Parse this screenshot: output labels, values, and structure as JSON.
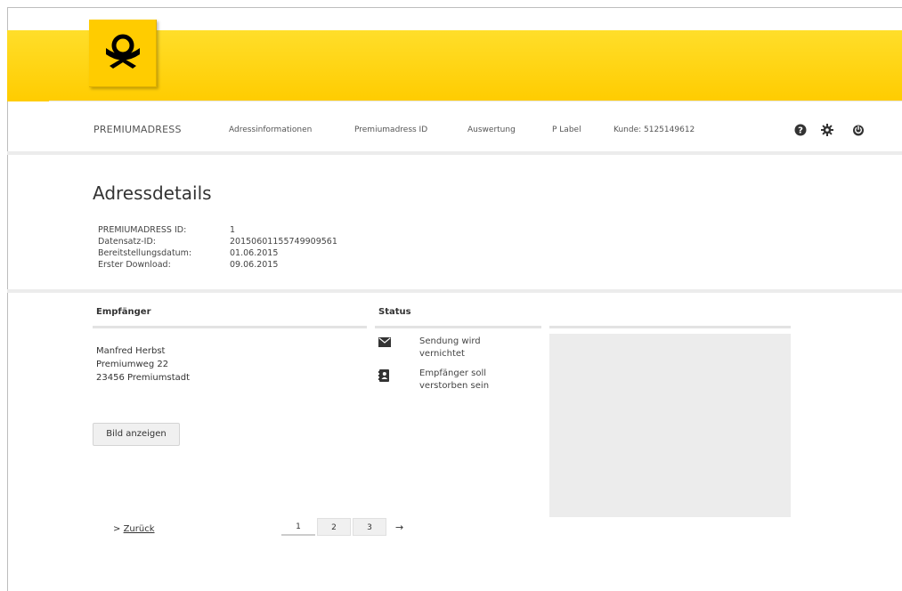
{
  "nav": {
    "brand": "PREMIUMADRESS",
    "items": [
      {
        "label": "Adressinformationen"
      },
      {
        "label": "Premiumadress ID"
      },
      {
        "label": "Auswertung"
      },
      {
        "label": "P Label"
      },
      {
        "label": "Kunde: 5125149612"
      }
    ],
    "icons": [
      "help-icon",
      "settings-icon",
      "power-icon"
    ]
  },
  "page": {
    "title": "Adressdetails",
    "meta": [
      {
        "label": "PREMIUMADRESS ID:",
        "value": "1"
      },
      {
        "label": "Datensatz-ID:",
        "value": "20150601155749909561"
      },
      {
        "label": "Bereitstellungsdatum:",
        "value": "01.06.2015"
      },
      {
        "label": "Erster Download:",
        "value": "09.06.2015"
      }
    ]
  },
  "recipient": {
    "heading": "Empfänger",
    "lines": [
      "Manfred Herbst",
      "Premiumweg 22",
      "23456 Premiumstadt"
    ],
    "button_label": "Bild anzeigen"
  },
  "status": {
    "heading": "Status",
    "entries": [
      {
        "icon": "envelope-icon",
        "text": "Sendung wird vernichtet"
      },
      {
        "icon": "address-book-icon",
        "text": "Empfänger soll verstorben sein"
      }
    ]
  },
  "footer": {
    "back_label": "Zurück",
    "back_glyph": ">",
    "pages": [
      "1",
      "2",
      "3"
    ],
    "current_page": "1",
    "next_glyph": "→"
  },
  "colors": {
    "brand_yellow": "#ffcc00",
    "brand_icon": "#000000"
  }
}
